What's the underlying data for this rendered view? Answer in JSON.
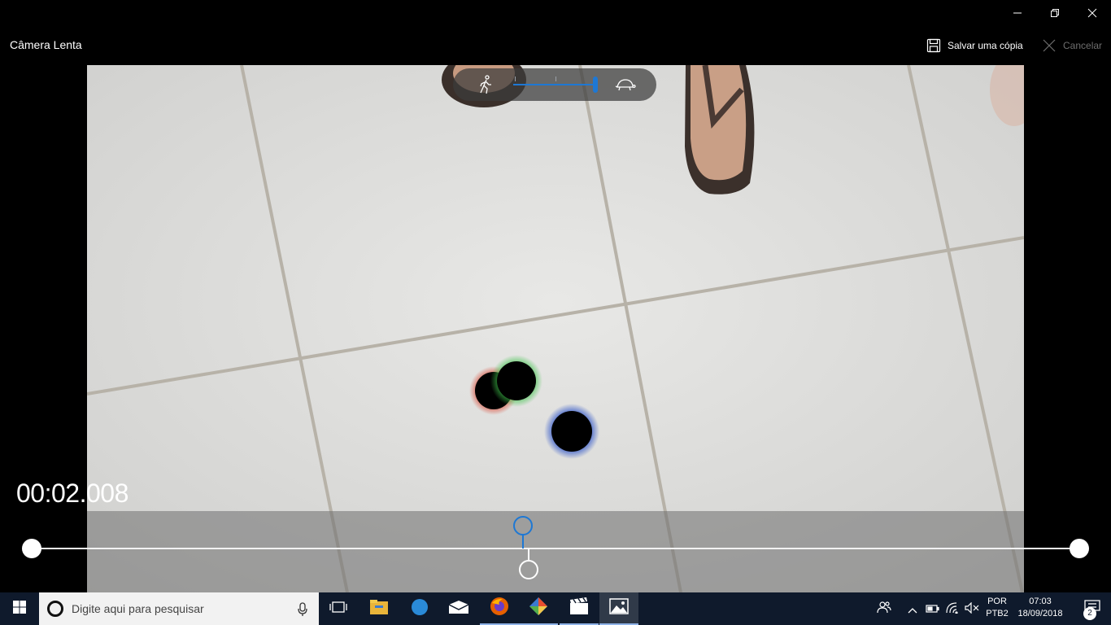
{
  "window": {
    "title": "Câmera Lenta",
    "minimize_icon": "minimize-icon",
    "restore_icon": "restore-icon",
    "close_icon": "close-icon"
  },
  "toolbar": {
    "save_label": "Salvar uma cópia",
    "save_icon": "save-icon",
    "cancel_label": "Cancelar",
    "cancel_icon": "close-icon"
  },
  "speed_control": {
    "left_icon": "walking-person-icon",
    "right_icon": "turtle-icon",
    "level": 1.0,
    "accent": "#1e78d4"
  },
  "player": {
    "timecode": "00:02.008",
    "playhead_position": 0.47,
    "slow_marker_position": 0.47
  },
  "taskbar": {
    "search_placeholder": "Digite aqui para pesquisar",
    "start_icon": "windows-start-icon",
    "apps": [
      {
        "name": "task-view-icon"
      },
      {
        "name": "file-explorer-icon"
      },
      {
        "name": "browser-icon"
      },
      {
        "name": "mail-icon"
      },
      {
        "name": "firefox-icon"
      },
      {
        "name": "git-icon"
      },
      {
        "name": "video-editor-icon"
      },
      {
        "name": "photos-icon"
      }
    ],
    "language_line1": "POR",
    "language_line2": "PTB2",
    "time": "07:03",
    "date": "18/09/2018",
    "notification_count": "2"
  }
}
